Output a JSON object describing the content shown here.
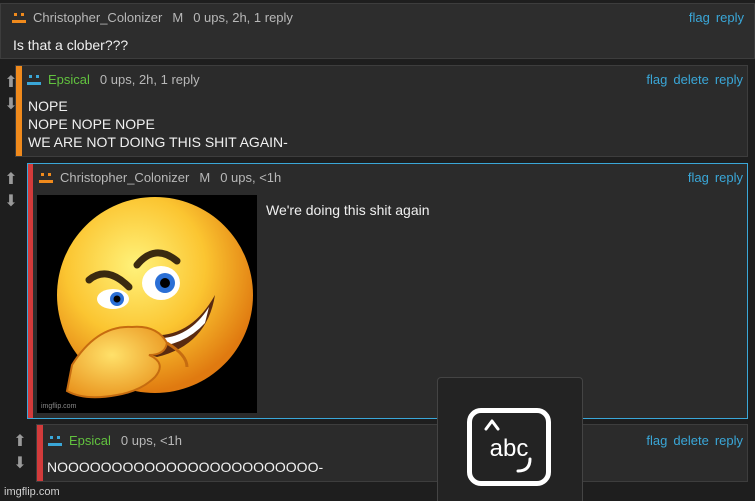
{
  "comments": [
    {
      "user": "Christopher_Colonizer",
      "mod": "M",
      "meta": "0 ups, 2h, 1 reply",
      "actions": [
        "flag",
        "reply"
      ],
      "body": "Is that a clober???"
    },
    {
      "user": "Epsical",
      "meta": "0 ups, 2h, 1 reply",
      "actions": [
        "flag",
        "delete",
        "reply"
      ],
      "body_lines": [
        "NOPE",
        "NOPE NOPE NOPE",
        "WE ARE NOT DOING THIS SHIT AGAIN-"
      ]
    },
    {
      "user": "Christopher_Colonizer",
      "mod": "M",
      "meta": "0 ups, <1h",
      "actions": [
        "flag",
        "reply"
      ],
      "body": "We're doing this shit again",
      "image": "smirking-emoji"
    },
    {
      "user": "Epsical",
      "meta": "0 ups, <1h",
      "actions": [
        "flag",
        "delete",
        "reply"
      ],
      "body": "NOOOOOOOOOOOOOOOOOOOOOOOO-"
    }
  ],
  "keyboard_toggle": {
    "label": "abc",
    "icon": "keyboard-toggle-icon"
  },
  "watermark": "imgflip.com",
  "colors": {
    "accent_link": "#3aa7d8",
    "orange_stripe": "#f08a1c",
    "red_stripe": "#d23b3b",
    "selected_border": "#3aa7d8",
    "green_user": "#62c23f",
    "orange_avatar": "#f08a1c",
    "blue_avatar": "#3aa7d8"
  }
}
